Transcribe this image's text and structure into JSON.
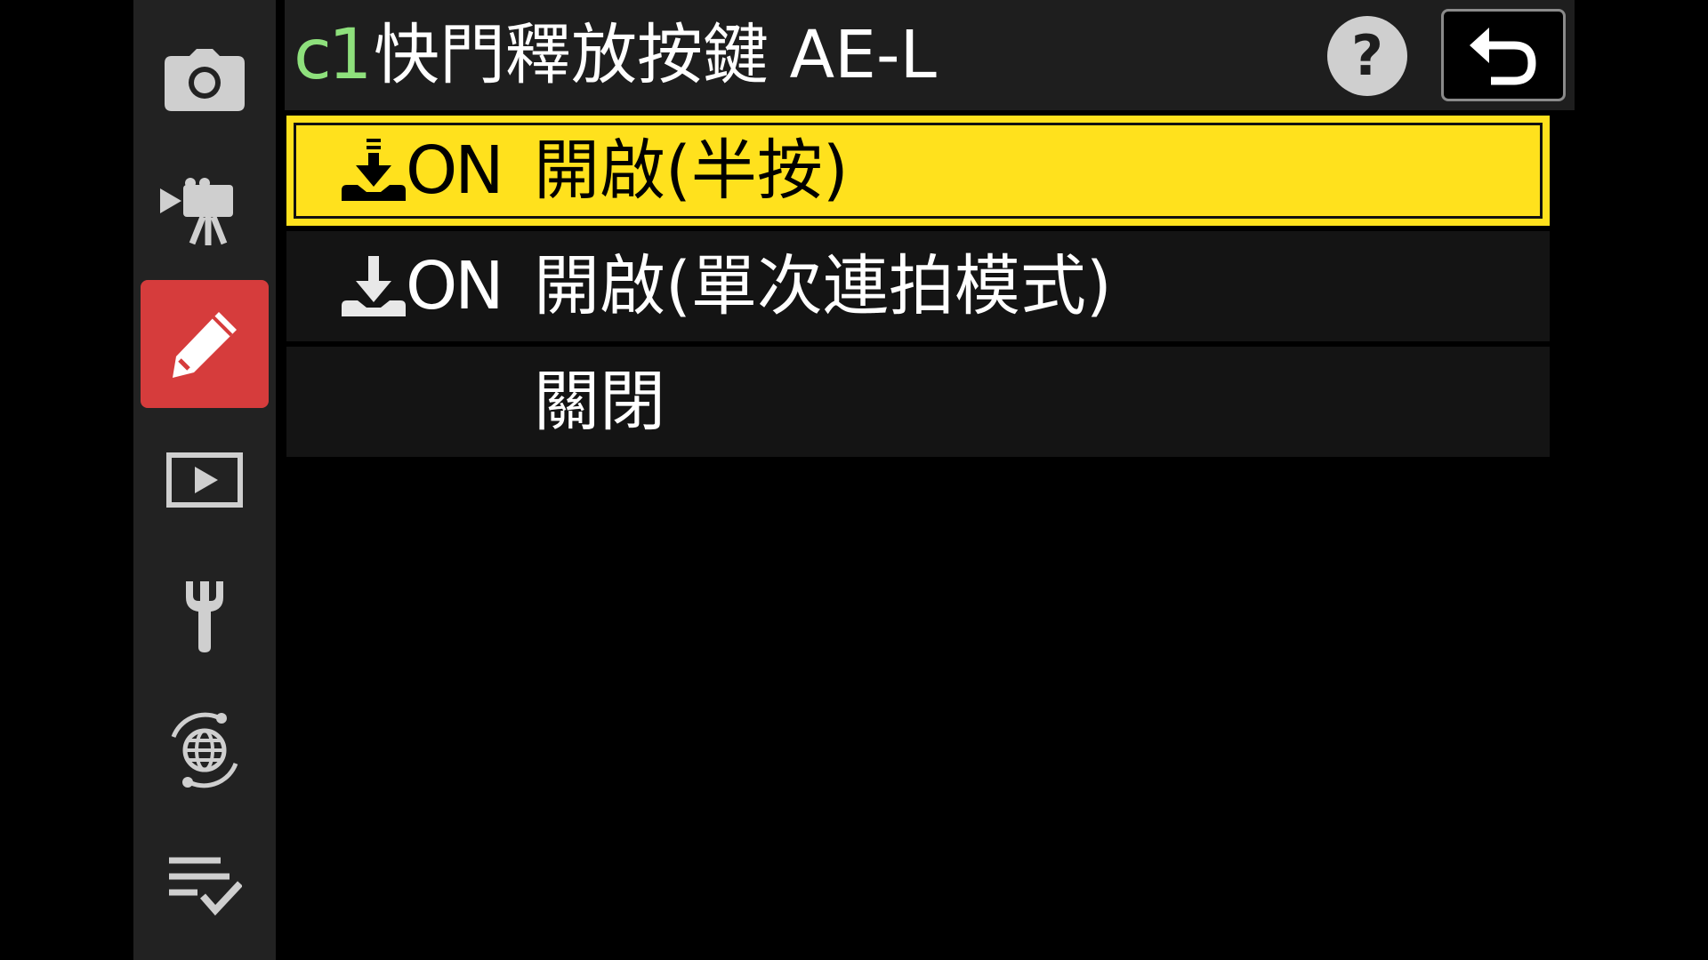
{
  "sidebar": {
    "items": [
      {
        "icon": "camera-icon",
        "active": false
      },
      {
        "icon": "movie-camera-icon",
        "active": false
      },
      {
        "icon": "pencil-icon",
        "active": true
      },
      {
        "icon": "playback-icon",
        "active": false
      },
      {
        "icon": "wrench-icon",
        "active": false
      },
      {
        "icon": "network-icon",
        "active": false
      },
      {
        "icon": "my-menu-icon",
        "active": false
      }
    ],
    "active_color": "#d63c3c"
  },
  "header": {
    "menu_code": "c1",
    "title": "快門釋放按鍵 AE-L",
    "help_label": "?",
    "code_color": "#8ee07c"
  },
  "options": [
    {
      "icon": "half-press-on-icon",
      "on_text": "ON",
      "label": "開啟(半按)",
      "selected": true
    },
    {
      "icon": "burst-on-icon",
      "on_text": "ON",
      "label": "開啟(單次連拍模式)",
      "selected": false
    },
    {
      "icon": "",
      "on_text": "",
      "label": "關閉",
      "selected": false
    }
  ],
  "colors": {
    "highlight": "#ffe11d",
    "background": "#000000"
  }
}
